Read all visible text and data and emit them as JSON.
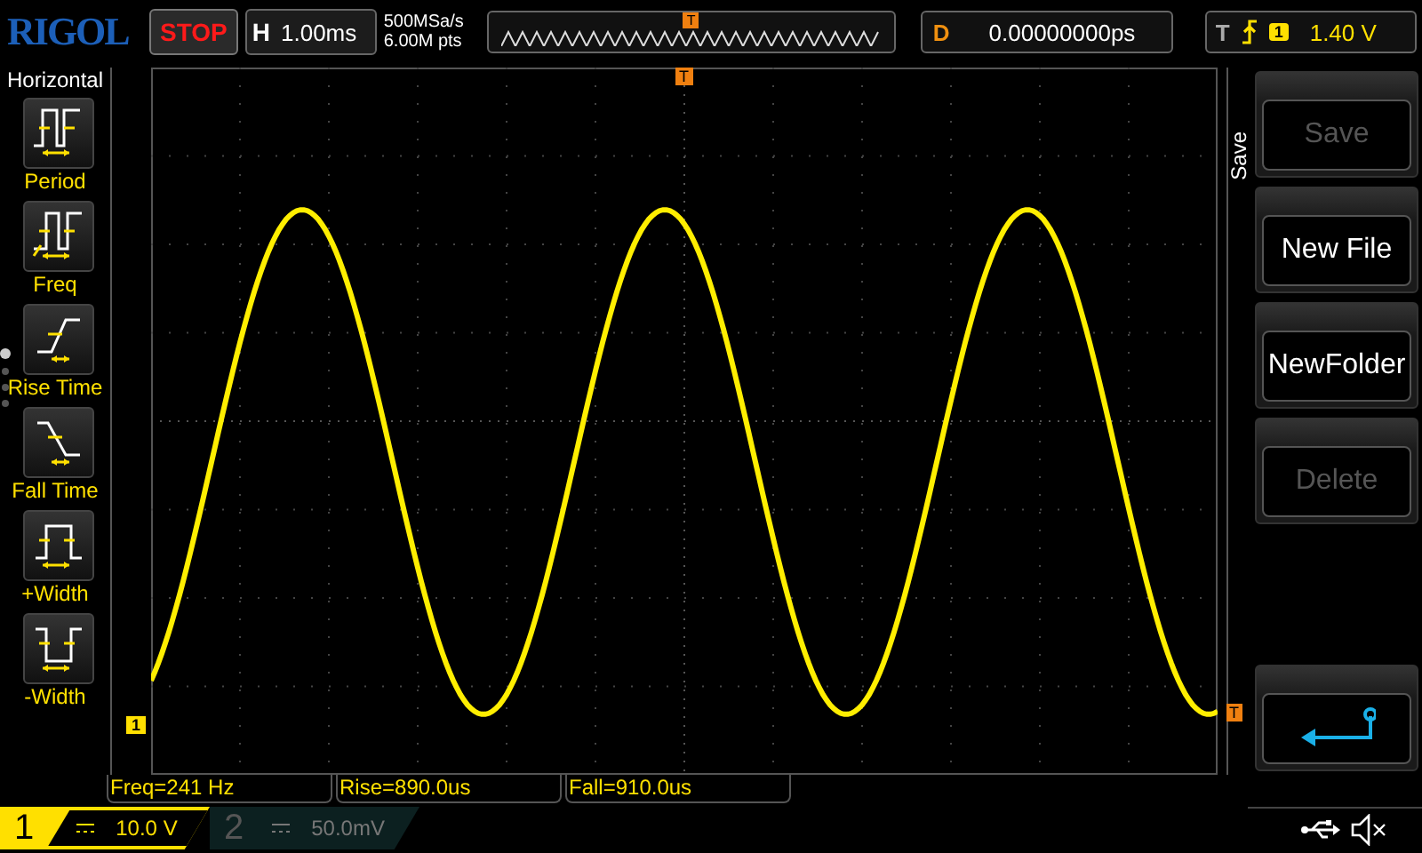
{
  "top_bar": {
    "logo": "RIGOL",
    "run_state": "STOP",
    "timebase": {
      "label": "H",
      "value": "1.00ms"
    },
    "sampling": {
      "rate": "500MSa/s",
      "depth": "6.00M pts"
    },
    "trigger_marker": "T",
    "delay": {
      "label": "D",
      "value": "0.00000000ps"
    },
    "trigger": {
      "label": "T",
      "source": "1",
      "level": "1.40 V"
    }
  },
  "left_menu": {
    "title": "Horizontal",
    "items": [
      {
        "label": "Period",
        "kind": "period"
      },
      {
        "label": "Freq",
        "kind": "freq"
      },
      {
        "label": "Rise Time",
        "kind": "rise"
      },
      {
        "label": "Fall Time",
        "kind": "fall"
      },
      {
        "label": "+Width",
        "kind": "pwidth"
      },
      {
        "label": "-Width",
        "kind": "nwidth"
      }
    ],
    "pages": [
      {
        "selected": true
      },
      {
        "selected": false
      },
      {
        "selected": false
      },
      {
        "selected": false
      }
    ]
  },
  "screen": {
    "trigger_marker": "T",
    "channel_marker": "1",
    "level_marker": "T"
  },
  "right_menu": {
    "title": "Save",
    "items": [
      {
        "kind": "text",
        "label": "Save",
        "disabled": true
      },
      {
        "kind": "text",
        "label": "New File",
        "disabled": false
      },
      {
        "kind": "text",
        "label": "NewFolder",
        "disabled": false
      },
      {
        "kind": "text",
        "label": "Delete",
        "disabled": true
      },
      {
        "kind": "back"
      }
    ]
  },
  "measurements": [
    "Freq=241 Hz",
    "Rise=890.0us",
    "Fall=910.0us"
  ],
  "channels": [
    {
      "number": "1",
      "scale": "10.0 V",
      "selected": true
    },
    {
      "number": "2",
      "scale": "50.0mV",
      "selected": false
    }
  ]
}
